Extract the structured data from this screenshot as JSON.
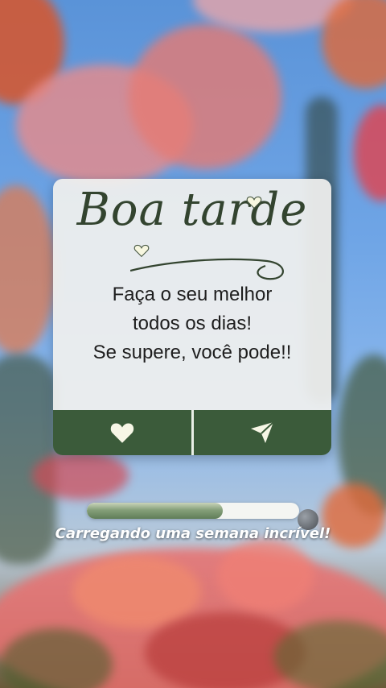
{
  "card": {
    "title": "Boa tarde",
    "message_lines": [
      "Faça o seu melhor",
      "todos os dias!",
      "Se supere, você pode!!"
    ]
  },
  "actions": {
    "like_icon": "heart-icon",
    "send_icon": "paper-plane-icon"
  },
  "progress": {
    "fraction": 0.64,
    "label": "Carregando uma semana incrível!"
  },
  "colors": {
    "card_text": "#33442f",
    "action_bar": "#3b5b3a",
    "progress_fill": "#5f7d58"
  }
}
